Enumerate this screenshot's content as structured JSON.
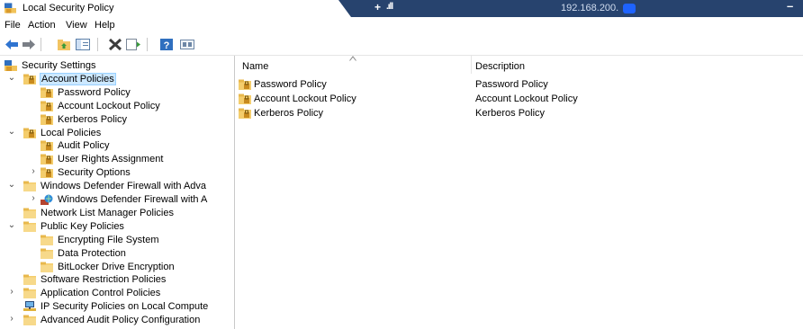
{
  "window": {
    "title": "Local Security Policy",
    "remote": {
      "host": "192.168.200.",
      "signal": ".ıll",
      "pin": "+",
      "minimize": "–"
    }
  },
  "menu": [
    "File",
    "Action",
    "View",
    "Help"
  ],
  "toolbar": {
    "icons": [
      "back-arrow-icon",
      "forward-arrow-icon",
      "up-folder-icon",
      "show-hide-tree-icon",
      "delete-icon",
      "export-list-icon",
      "help-icon",
      "properties-icon"
    ]
  },
  "tree": [
    {
      "label": "Security Settings",
      "level": 0,
      "toggle": "",
      "icon": "security-settings-icon",
      "selected": false
    },
    {
      "label": "Account Policies",
      "level": 1,
      "toggle": "⌄",
      "icon": "policy-folder-icon",
      "selected": true
    },
    {
      "label": "Password Policy",
      "level": 2,
      "toggle": "",
      "icon": "policy-folder-icon",
      "selected": false
    },
    {
      "label": "Account Lockout Policy",
      "level": 2,
      "toggle": "",
      "icon": "policy-folder-icon",
      "selected": false
    },
    {
      "label": "Kerberos Policy",
      "level": 2,
      "toggle": "",
      "icon": "policy-folder-icon",
      "selected": false
    },
    {
      "label": "Local Policies",
      "level": 1,
      "toggle": "⌄",
      "icon": "policy-folder-icon",
      "selected": false
    },
    {
      "label": "Audit Policy",
      "level": 2,
      "toggle": "",
      "icon": "policy-folder-icon",
      "selected": false
    },
    {
      "label": "User Rights Assignment",
      "level": 2,
      "toggle": "",
      "icon": "policy-folder-icon",
      "selected": false
    },
    {
      "label": "Security Options",
      "level": 2,
      "toggle": "›",
      "icon": "policy-folder-icon",
      "selected": false
    },
    {
      "label": "Windows Defender Firewall with Adva",
      "level": 1,
      "toggle": "⌄",
      "icon": "folder-icon",
      "selected": false
    },
    {
      "label": "Windows Defender Firewall with A",
      "level": 2,
      "toggle": "›",
      "icon": "firewall-icon",
      "selected": false
    },
    {
      "label": "Network List Manager Policies",
      "level": 1,
      "toggle": "",
      "icon": "folder-icon",
      "selected": false
    },
    {
      "label": "Public Key Policies",
      "level": 1,
      "toggle": "⌄",
      "icon": "folder-icon",
      "selected": false
    },
    {
      "label": "Encrypting File System",
      "level": 2,
      "toggle": "",
      "icon": "folder-icon",
      "selected": false
    },
    {
      "label": "Data Protection",
      "level": 2,
      "toggle": "",
      "icon": "folder-icon",
      "selected": false
    },
    {
      "label": "BitLocker Drive Encryption",
      "level": 2,
      "toggle": "",
      "icon": "folder-icon",
      "selected": false
    },
    {
      "label": "Software Restriction Policies",
      "level": 1,
      "toggle": "",
      "icon": "folder-icon",
      "selected": false
    },
    {
      "label": "Application Control Policies",
      "level": 1,
      "toggle": "›",
      "icon": "folder-icon",
      "selected": false
    },
    {
      "label": "IP Security Policies on Local Compute",
      "level": 1,
      "toggle": "",
      "icon": "ip-security-icon",
      "selected": false
    },
    {
      "label": "Advanced Audit Policy Configuration",
      "level": 1,
      "toggle": "›",
      "icon": "folder-icon",
      "selected": false
    }
  ],
  "list": {
    "columns": [
      "Name",
      "Description"
    ],
    "rows": [
      {
        "name": "Password Policy",
        "description": "Password Policy"
      },
      {
        "name": "Account Lockout Policy",
        "description": "Account Lockout Policy"
      },
      {
        "name": "Kerberos Policy",
        "description": "Kerberos Policy"
      }
    ]
  }
}
